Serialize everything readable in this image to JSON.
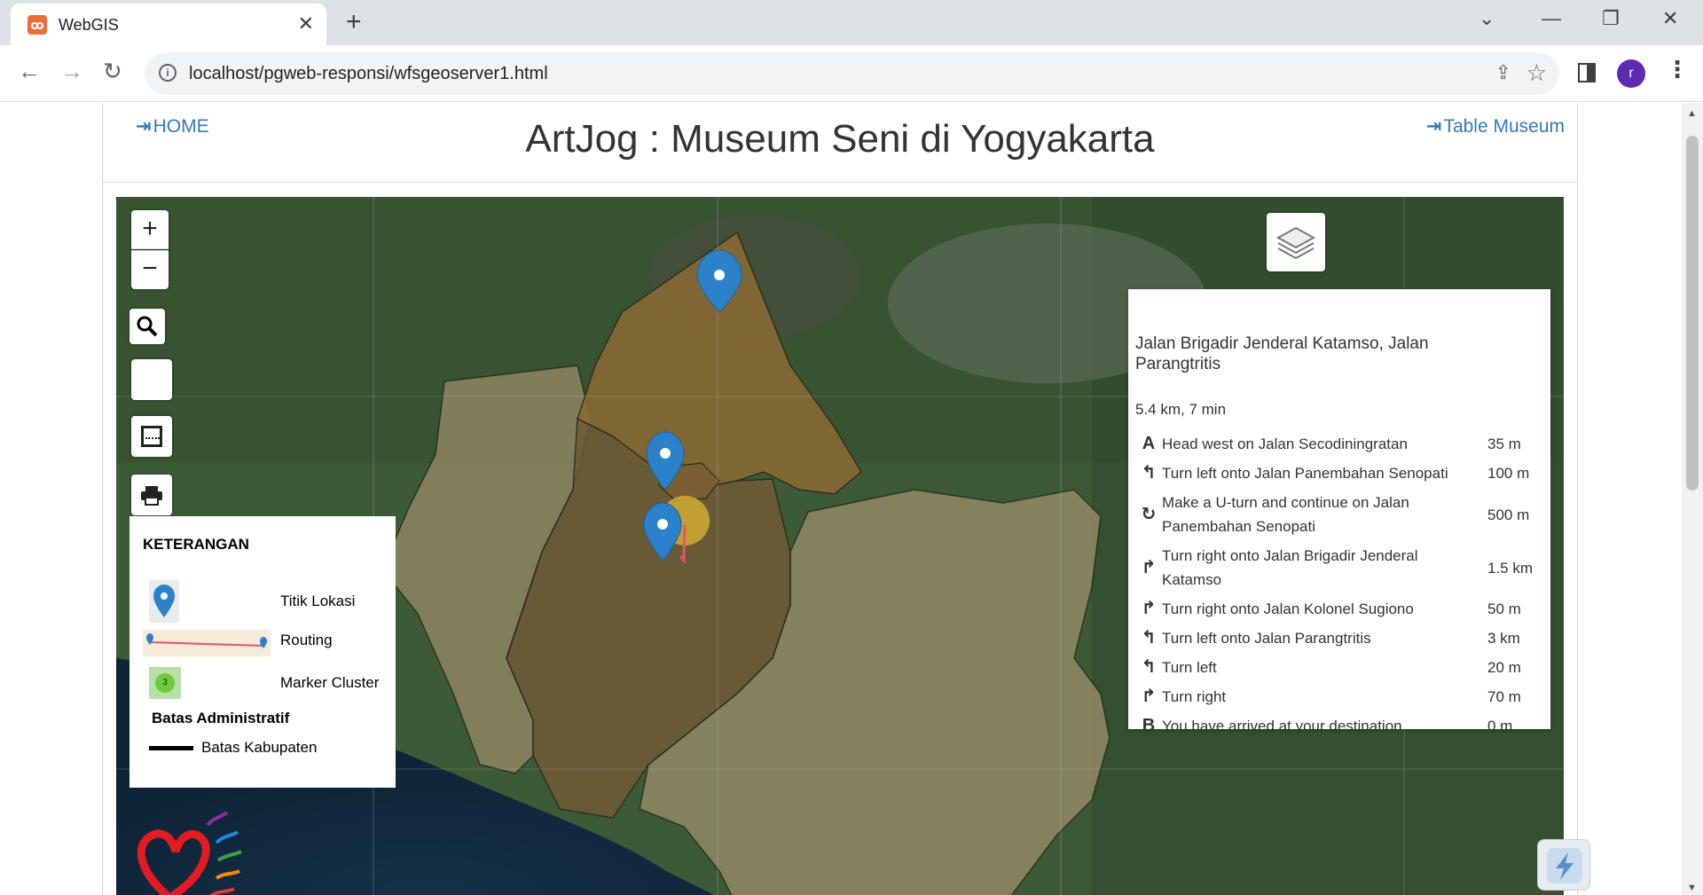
{
  "browser": {
    "tab_title": "WebGIS",
    "tab_close": "✕",
    "new_tab": "+",
    "url": "localhost/pgweb-responsi/wfsgeoserver1.html",
    "avatar_letter": "r",
    "window_controls": {
      "dropdown": "⌄",
      "minimize": "—",
      "restore": "❐",
      "close": "✕"
    }
  },
  "header": {
    "home_link": "HOME",
    "title": "ArtJog : Museum Seni di Yogyakarta",
    "table_link": "Table Museum"
  },
  "map": {
    "zoom_in": "+",
    "zoom_out": "−",
    "legend": {
      "title": "KETERANGAN",
      "items": [
        {
          "label": "Titik Lokasi"
        },
        {
          "label": "Routing"
        },
        {
          "label": "Marker Cluster",
          "cluster_count": "3"
        }
      ],
      "subtitle": "Batas Administratif",
      "line_label": "Batas Kabupaten"
    },
    "routing": {
      "name": "Jalan Brigadir Jenderal Katamso, Jalan Parangtritis",
      "summary": "5.4 km, 7 min",
      "steps": [
        {
          "icon": "A",
          "text": "Head west on Jalan Secodiningratan",
          "distance": "35 m"
        },
        {
          "icon": "↰",
          "text": "Turn left onto Jalan Panembahan Senopati",
          "distance": "100 m"
        },
        {
          "icon": "↻",
          "text": "Make a U-turn and continue on Jalan Panembahan Senopati",
          "distance": "500 m"
        },
        {
          "icon": "↱",
          "text": "Turn right onto Jalan Brigadir Jenderal Katamso",
          "distance": "1.5 km"
        },
        {
          "icon": "↱",
          "text": "Turn right onto Jalan Kolonel Sugiono",
          "distance": "50 m"
        },
        {
          "icon": "↰",
          "text": "Turn left onto Jalan Parangtritis",
          "distance": "3 km"
        },
        {
          "icon": "↰",
          "text": "Turn left",
          "distance": "20 m"
        },
        {
          "icon": "↱",
          "text": "Turn right",
          "distance": "70 m"
        },
        {
          "icon": "B",
          "text": "You have arrived at your destination",
          "distance": "0 m"
        }
      ]
    }
  },
  "colors": {
    "link": "#337ab7",
    "marker": "#2b82cb",
    "region_fill": "#8a6a35",
    "region_alt_fill": "#8c8660"
  }
}
